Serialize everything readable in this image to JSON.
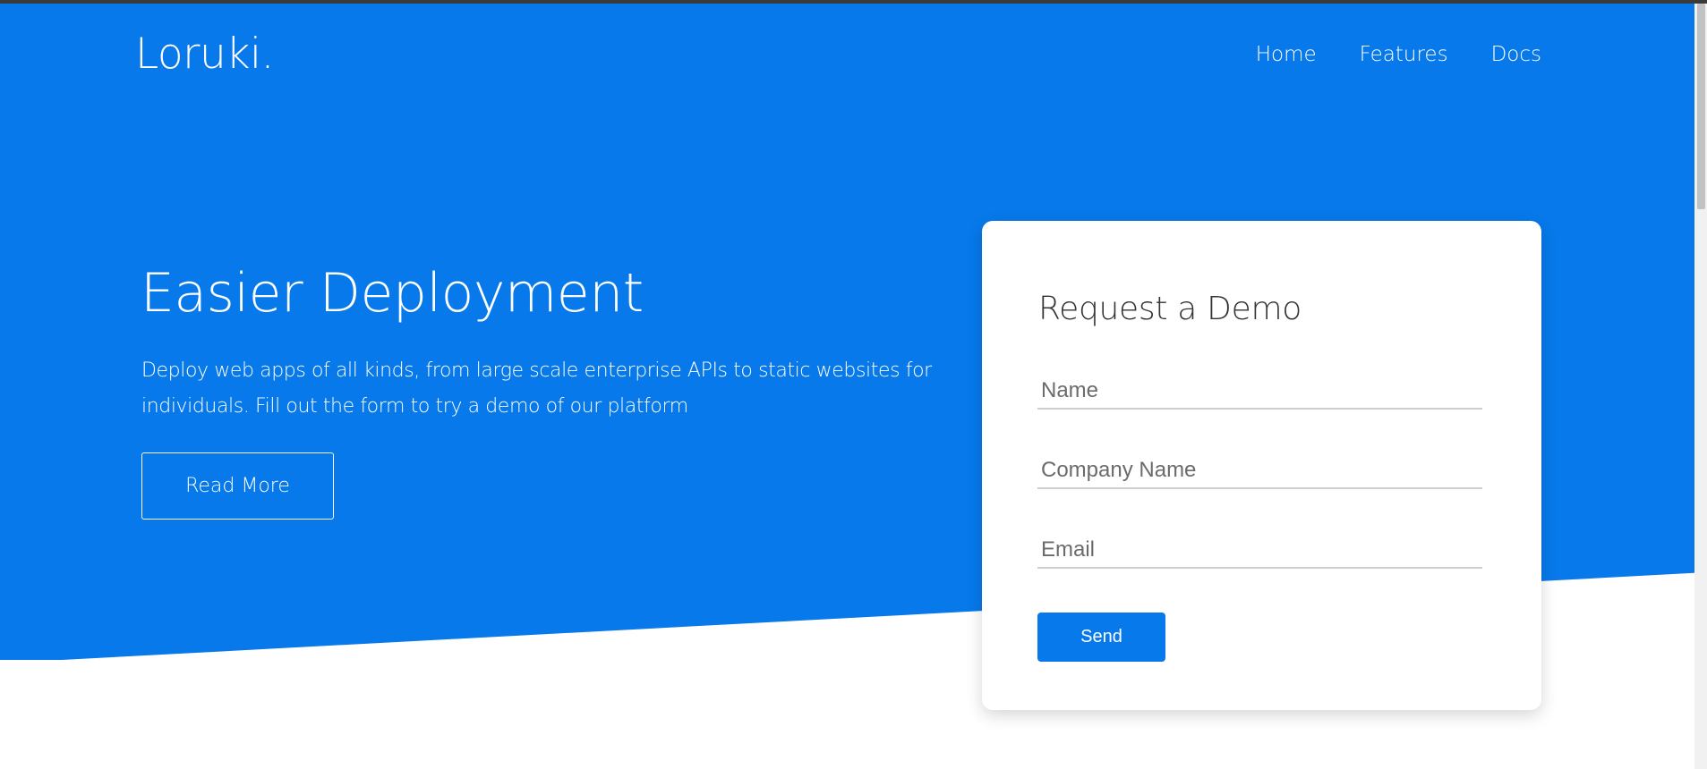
{
  "brand": {
    "name": "Loruki."
  },
  "nav": {
    "items": [
      {
        "label": "Home"
      },
      {
        "label": "Features"
      },
      {
        "label": "Docs"
      }
    ]
  },
  "hero": {
    "title": "Easier Deployment",
    "text": "Deploy web apps of all kinds, from large scale enterprise APIs to static websites for individuals. Fill out the form to try a demo of our platform",
    "read_more_label": "Read More"
  },
  "demo_form": {
    "title": "Request a Demo",
    "name_placeholder": "Name",
    "company_placeholder": "Company Name",
    "email_placeholder": "Email",
    "send_label": "Send"
  },
  "colors": {
    "primary": "#0779ea",
    "text_dark": "#333333",
    "white": "#ffffff"
  }
}
